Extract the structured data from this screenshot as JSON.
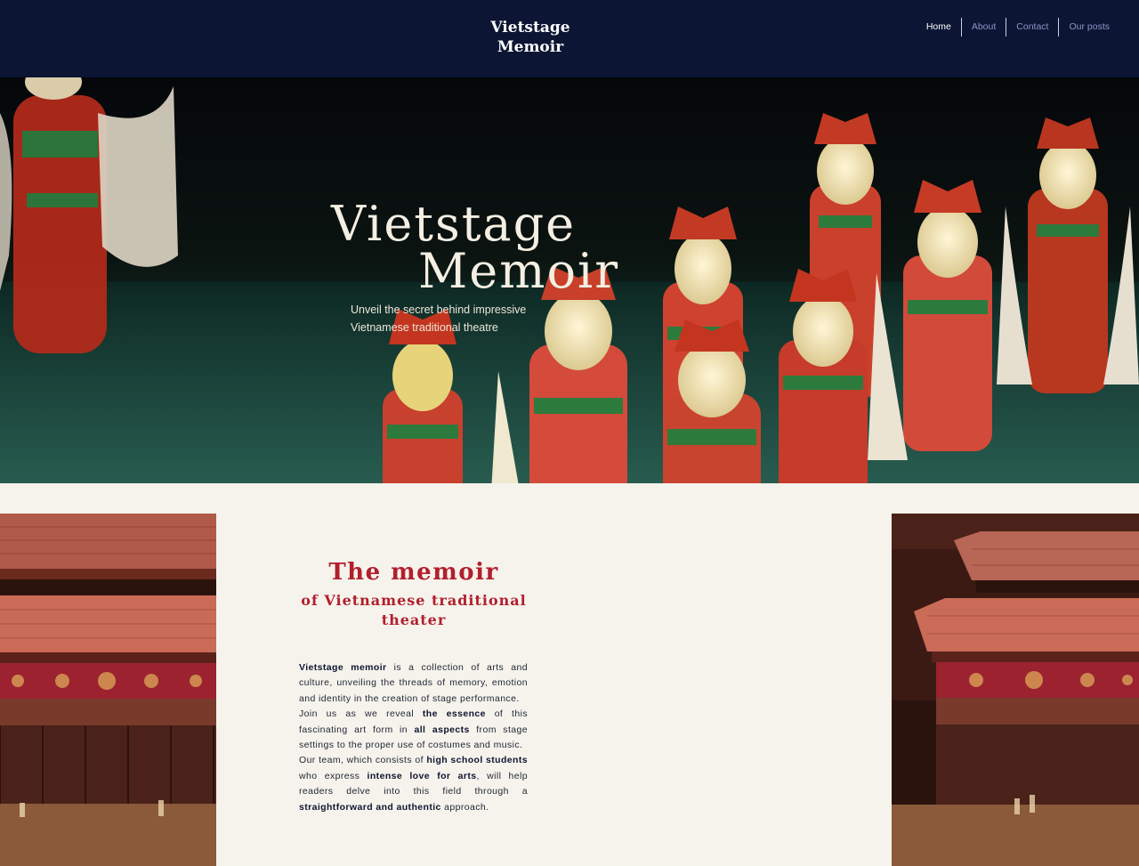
{
  "header": {
    "logo_line1": "Vietstage",
    "logo_line2": "Memoir",
    "nav": [
      {
        "label": "Home",
        "active": true
      },
      {
        "label": "About",
        "active": false
      },
      {
        "label": "Contact",
        "active": false
      },
      {
        "label": "Our posts",
        "active": false
      }
    ]
  },
  "hero": {
    "title_line1": "Vietstage",
    "title_line2": "Memoir",
    "subtitle_line1": "Unveil the secret behind impressive",
    "subtitle_line2": "Vietnamese traditional theatre",
    "image": "water-puppets-photo"
  },
  "memoir": {
    "title": "The memoir",
    "subtitle": "of Vietnamese traditional theater",
    "left_image": "water-puppet-theatre-stage-photo",
    "right_image": "water-puppet-theatre-stage-photo",
    "paragraphs": [
      [
        {
          "text": "Vietstage memoir",
          "bold": true
        },
        {
          "text": " is a collection of arts and culture, unveiling the threads of memory, emotion and identity in the creation of stage performance.",
          "bold": false
        }
      ],
      [
        {
          "text": "Join us as we reveal ",
          "bold": false
        },
        {
          "text": "the essence",
          "bold": true
        },
        {
          "text": " of this fascinating art form in ",
          "bold": false
        },
        {
          "text": "all aspects",
          "bold": true
        },
        {
          "text": " from stage settings to the proper use of costumes and music.",
          "bold": false
        }
      ],
      [
        {
          "text": "Our team, which consists of ",
          "bold": false
        },
        {
          "text": "high school students",
          "bold": true
        },
        {
          "text": " who express ",
          "bold": false
        },
        {
          "text": "intense love for arts",
          "bold": true
        },
        {
          "text": ", will help readers delve into this field through a ",
          "bold": false
        },
        {
          "text": "straightforward and authentic",
          "bold": true
        },
        {
          "text": " approach.",
          "bold": false
        }
      ]
    ]
  },
  "colors": {
    "header_bg": "#0c1634",
    "accent_red": "#b21f2d",
    "page_bg": "#f5f3ec"
  }
}
